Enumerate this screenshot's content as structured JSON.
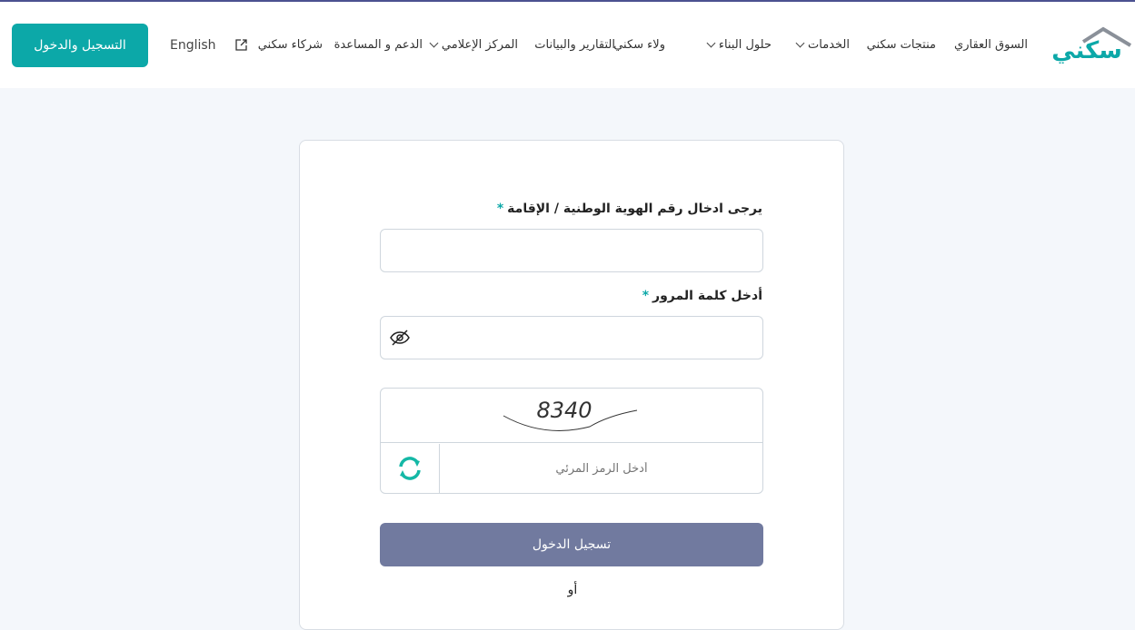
{
  "header": {
    "logo_text": "سكني",
    "nav": [
      {
        "label": "السوق العقاري",
        "dropdown": false
      },
      {
        "label": "منتجات سكني",
        "dropdown": false
      },
      {
        "label": "الخدمات",
        "dropdown": true
      },
      {
        "label": "حلول البناء",
        "dropdown": true
      },
      {
        "label": "ولاء سكني",
        "dropdown": false
      },
      {
        "label": "التقارير والبيانات",
        "dropdown": false
      },
      {
        "label": "المركز الإعلامي",
        "dropdown": true
      },
      {
        "label": "الدعم و المساعدة",
        "dropdown": false
      },
      {
        "label": "شركاء سكني",
        "external": true
      }
    ],
    "language": "English",
    "login_button": "التسجيل والدخول"
  },
  "form": {
    "id_label": "يرجى ادخال رقم الهوية الوطنية / الإقامة",
    "id_value": "",
    "password_label": "أدخل كلمة المرور",
    "password_value": "",
    "required_mark": "*",
    "captcha_text": "8340",
    "captcha_placeholder": "أدخل الرمز المرئي",
    "submit": "تسجيل الدخول",
    "or": "أو"
  },
  "colors": {
    "accent": "#0ca8a8",
    "submit": "#717a9f",
    "topline": "#4b5190"
  }
}
